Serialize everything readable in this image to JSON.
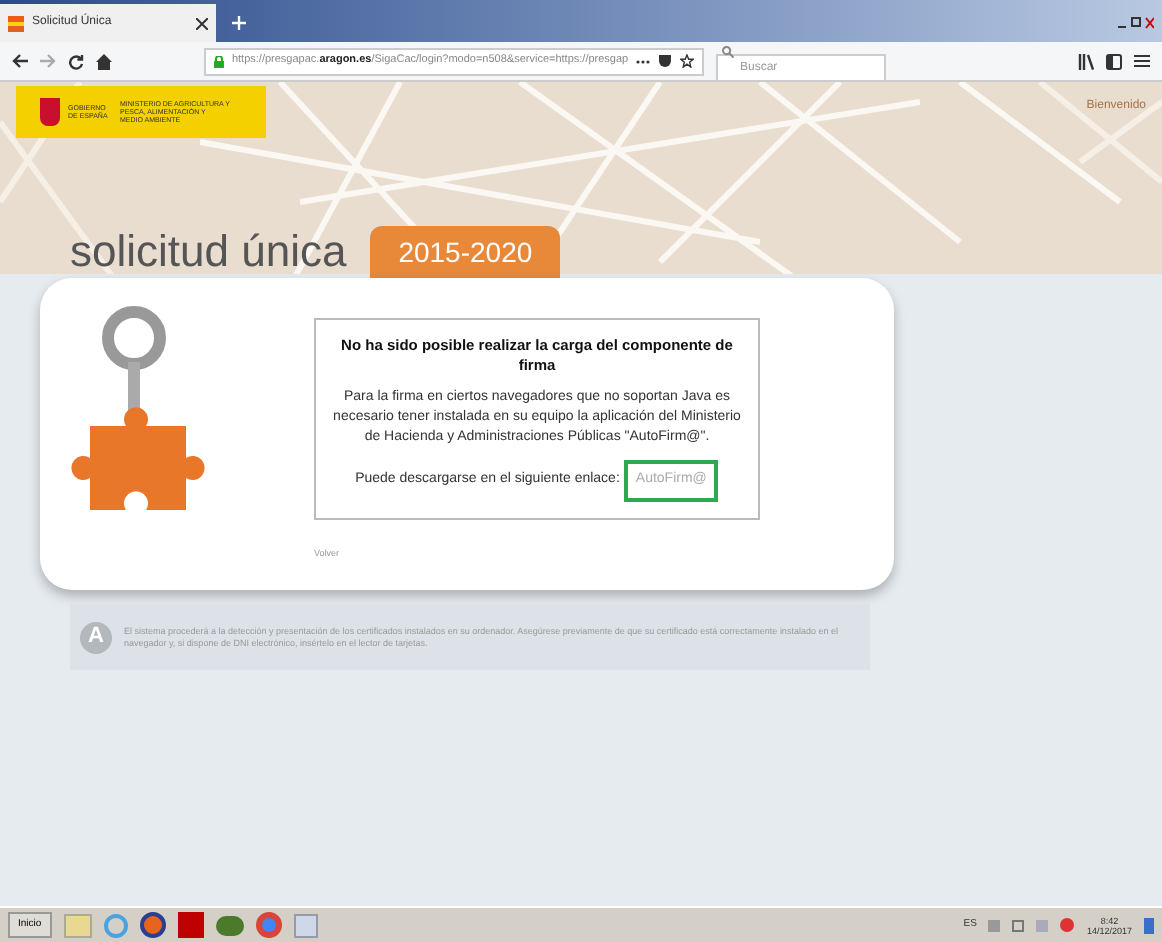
{
  "browser": {
    "tab_title": "Solicitud Única",
    "url_prefix": "https://presgapac.",
    "url_domain": "aragon.es",
    "url_rest": "/SigaCac/login?modo=n508&service=https://presgap",
    "search": {
      "placeholder": "Buscar"
    }
  },
  "header": {
    "logo_left": "GOBIERNO DE ESPAÑA",
    "logo_right": "MINISTERIO DE AGRICULTURA Y PESCA, ALIMENTACIÓN Y MEDIO AMBIENTE",
    "welcome": "Bienvenido"
  },
  "title": "solicitud única",
  "period": "2015-2020",
  "message": {
    "heading": "No ha sido posible realizar la carga del componente de firma",
    "body": "Para la firma en ciertos navegadores que no soportan Java es necesario tener instalada en su equipo la aplicación del Ministerio de Hacienda y Administraciones Públicas \"AutoFirm@\".",
    "download_text": "Puede descargarse en el siguiente enlace:",
    "link": {
      "label": "AutoFirm@",
      "highlighted": true
    }
  },
  "back_link": "Volver",
  "info": {
    "badge": "A",
    "text": "El sistema procederá a la detección y presentación de los certificados instalados en su ordenador. Asegúrese previamente de que su certificado está correctamente instalado en el navegador y, si dispone de DNI electrónico, insértelo en el lector de tarjetas."
  },
  "taskbar": {
    "start": "Inicio",
    "language": "ES",
    "time": "8:42",
    "date": "14/12/2017"
  }
}
